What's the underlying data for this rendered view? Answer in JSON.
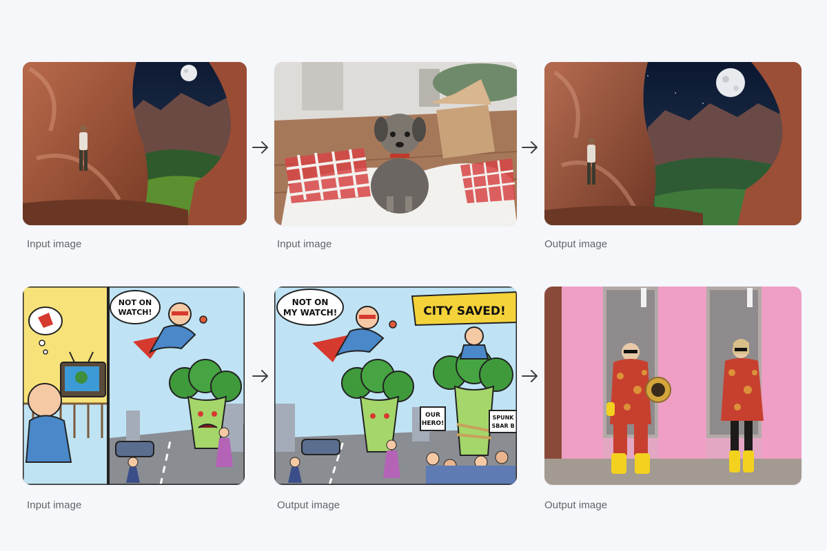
{
  "rows": [
    {
      "items": [
        {
          "caption": "Input image",
          "image": "canyon-cave-night-moon-man"
        },
        {
          "caption": "Input image",
          "image": "terrier-puppy-gift-box-checkered-paper"
        },
        {
          "caption": "Output image",
          "image": "puppy-cave-composite-night-moon-man"
        }
      ]
    },
    {
      "items": [
        {
          "caption": "Input image",
          "image": "comic-baby-superhero-broccoli"
        },
        {
          "caption": "Output image",
          "image": "comic-baby-hero-captures-broccoli"
        },
        {
          "caption": "Output image",
          "image": "two-people-red-print-outfits-pink-storefront"
        }
      ]
    }
  ],
  "comic1": {
    "speech": [
      "NOT ON",
      "WATCH!"
    ]
  },
  "comic2": {
    "speech": [
      "NOT ON",
      "MY WATCH!"
    ],
    "banner": "CITY SAVED!",
    "sign1": [
      "OUR",
      "HERO!"
    ],
    "sign2": [
      "SPUNK",
      "SBAR B"
    ]
  },
  "icons": {
    "arrow": "arrow-right-icon"
  },
  "colors": {
    "background": "#f6f7fa",
    "caption": "#5f6368",
    "arrow": "#3c4043"
  }
}
